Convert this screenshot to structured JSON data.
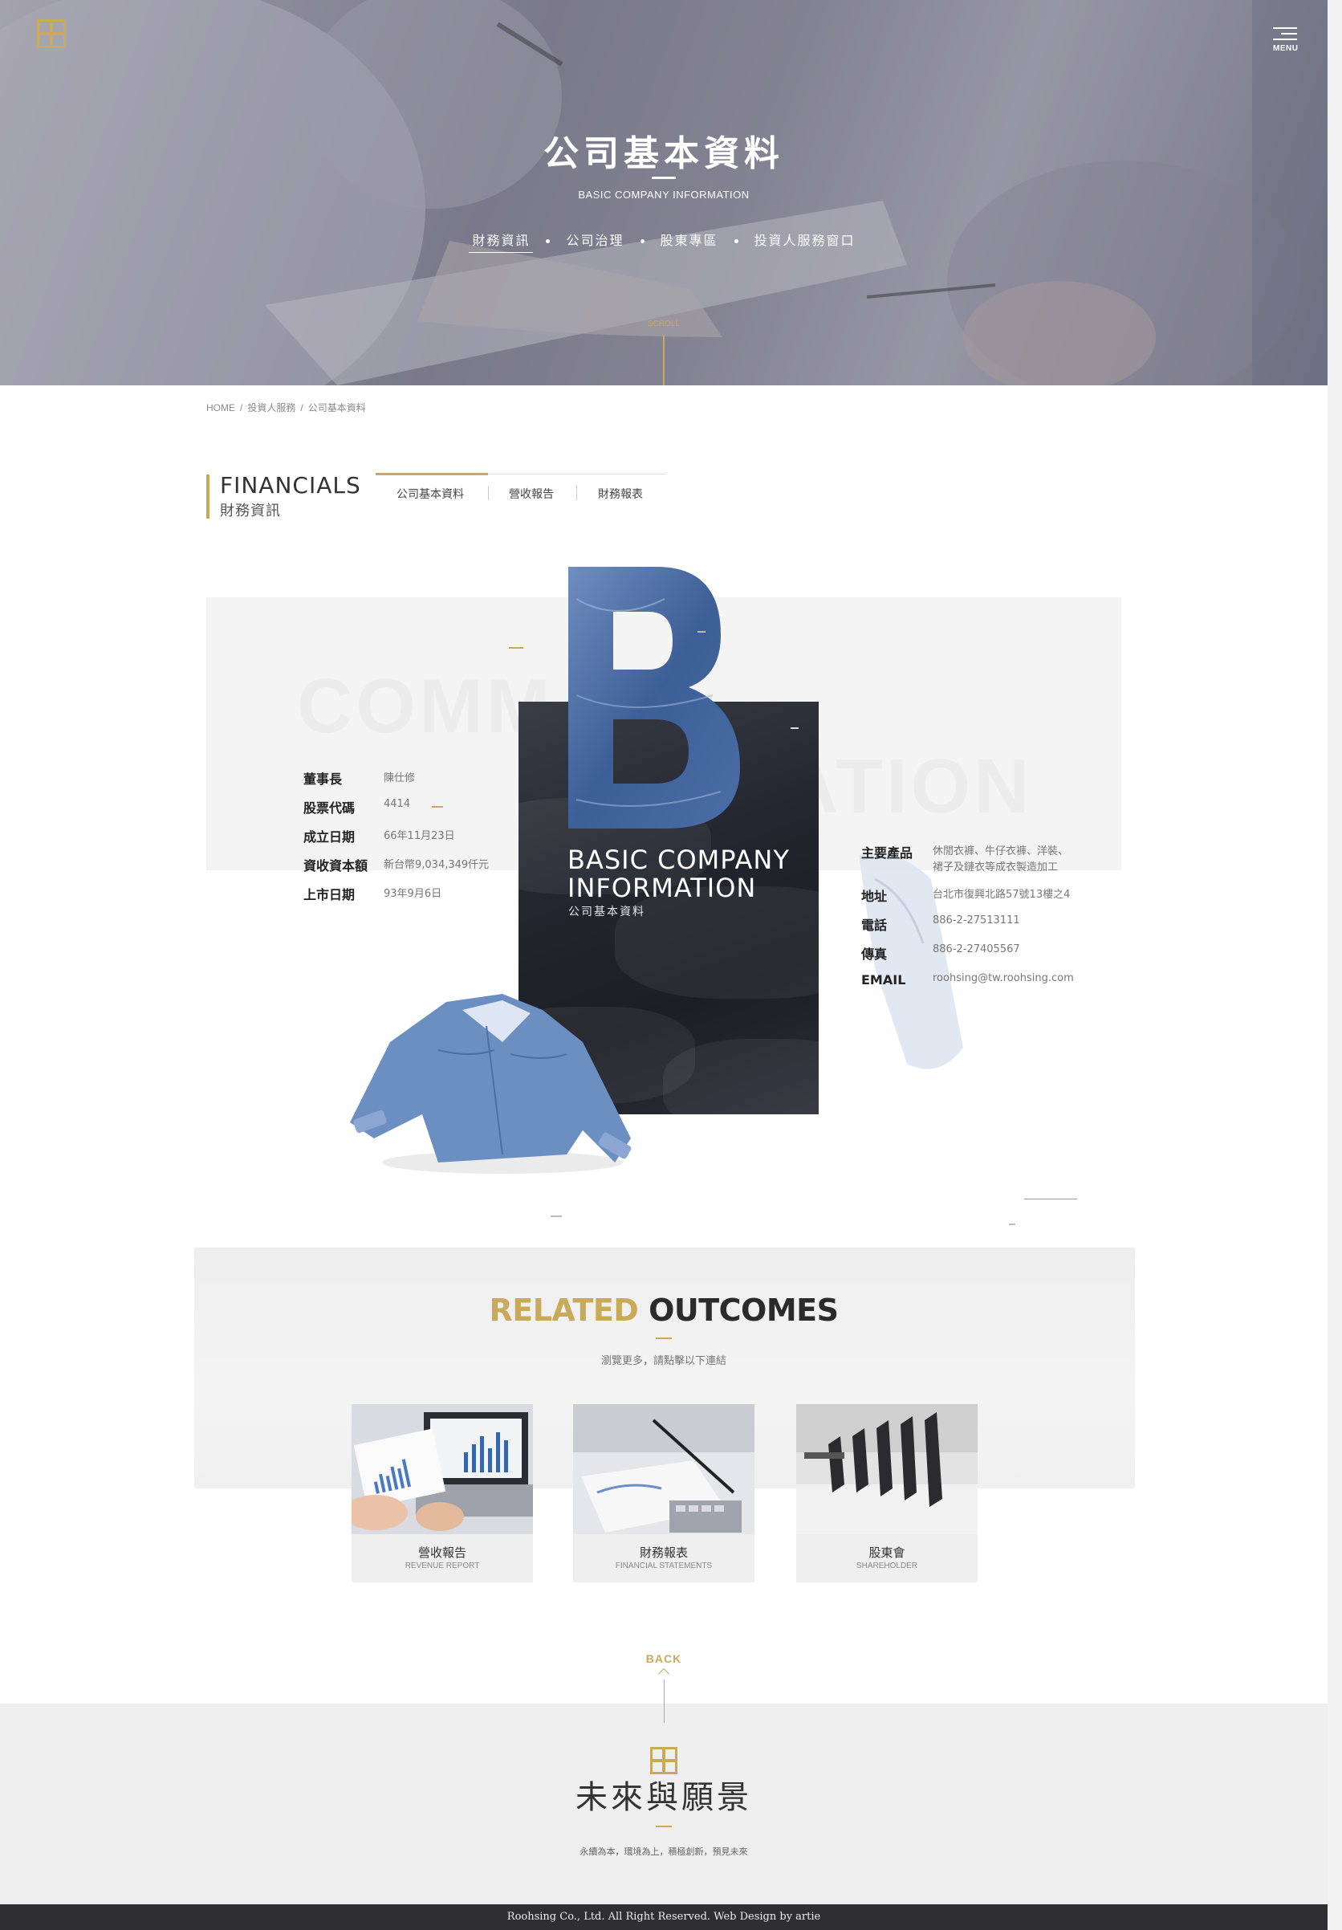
{
  "header": {
    "title": "公司基本資料",
    "subtitle": "BASIC COMPANY INFORMATION",
    "menu_label": "MENU",
    "scroll_label": "SCROLL",
    "nav": [
      "財務資訊",
      "公司治理",
      "股東專區",
      "投資人服務窗口"
    ]
  },
  "breadcrumb": [
    "HOME",
    "/",
    "投資人服務",
    "/",
    "公司基本資料"
  ],
  "financials": {
    "title_en": "FINANCIALS",
    "title_zh": "財務資訊",
    "tabs": [
      "公司基本資料",
      "營收報告",
      "財務報表"
    ]
  },
  "feature": {
    "ghost_left": "COMM",
    "ghost_right": "ATION",
    "big_letter": "B",
    "panel_title_line1": "BASIC COMPANY",
    "panel_title_line2": "INFORMATION",
    "panel_subtitle": "公司基本資料"
  },
  "info_left": [
    {
      "label": "董事長",
      "value": "陳仕修"
    },
    {
      "label": "股票代碼",
      "value": "4414"
    },
    {
      "label": "成立日期",
      "value": "66年11月23日"
    },
    {
      "label": "資收資本額",
      "value": "新台幣9,034,349仟元"
    },
    {
      "label": "上市日期",
      "value": "93年9月6日"
    }
  ],
  "info_right": [
    {
      "label": "主要產品",
      "value": "休閒衣褲、牛仔衣褲、洋裝、",
      "value2": "裙子及鏈衣等成衣製造加工"
    },
    {
      "label": "地址",
      "value": "台北市復興北路57號13樓之4"
    },
    {
      "label": "電話",
      "value": "886-2-27513111"
    },
    {
      "label": "傳真",
      "value": "886-2-27405567"
    },
    {
      "label": "EMAIL",
      "value": "roohsing@tw.roohsing.com"
    }
  ],
  "related": {
    "title_gold": "RELATED",
    "title_dark": "OUTCOMES",
    "desc": "瀏覽更多，請點擊以下連結",
    "cards": [
      {
        "zh": "營收報告",
        "en": "REVENUE REPORT"
      },
      {
        "zh": "財務報表",
        "en": "FINANCIAL STATEMENTS"
      },
      {
        "zh": "股東會",
        "en": "SHAREHOLDER"
      }
    ]
  },
  "back_label": "BACK",
  "footer": {
    "title": "未來與願景",
    "slogan": "永續為本，環境為上，積極創新，預見未來",
    "copyright": "Roohsing Co., Ltd. All Right Reserved. Web Design by artie"
  },
  "colors": {
    "accent": "#c9a95a",
    "dark": "#2f2f31"
  }
}
